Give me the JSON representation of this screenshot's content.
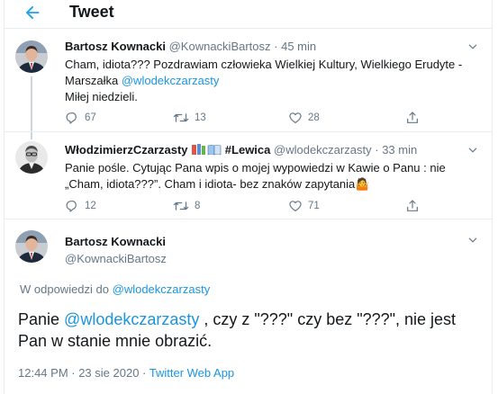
{
  "header": {
    "title": "Tweet"
  },
  "tweets": [
    {
      "name": "Bartosz Kownacki",
      "handle": "@KownackiBartosz",
      "dot": "·",
      "time": "45 min",
      "text_line1": "Cham, idiota??? Pozdrawiam człowieka Wielkiej Kultury, Wielkiego Erudyte -",
      "text_line2_prefix": "Marszałka ",
      "text_line2_mention": "@wlodekczarzasty",
      "text_line3": "Miłej niedzieli.",
      "replies": "67",
      "retweets": "13",
      "likes": "28"
    },
    {
      "name": "WłodzimierzCzarzasty",
      "badge_text": "#Lewica",
      "handle": "@wlodekczarzasty",
      "dot": "·",
      "time": "33 min",
      "text_line1": "Panie pośle. Cytując Pana wpis o mojej wypowiedzi w Kawie o Panu : nie",
      "text_line2": "„Cham, idiota???”.  Cham i idiota- bez znaków zapytania",
      "emoji": "🤷",
      "replies": "12",
      "retweets": "8",
      "likes": "71"
    }
  ],
  "main": {
    "name": "Bartosz Kownacki",
    "handle": "@KownackiBartosz",
    "reply_prefix": "W odpowiedzi do ",
    "reply_mention": "@wlodekczarzasty",
    "text_prefix": "Panie ",
    "text_mention": "@wlodekczarzasty",
    "text_rest": " , czy z \"???\" czy bez \"???\", nie jest Pan w stanie mnie obrazić.",
    "timestamp": "12:44 PM · 23 sie 2020 · ",
    "source": "Twitter Web App"
  },
  "colors": {
    "accent": "#1b95e0",
    "muted": "#657786",
    "border": "#e6ecf0"
  },
  "icons": [
    "back-arrow-icon",
    "chevron-down-icon",
    "reply-icon",
    "retweet-icon",
    "like-icon",
    "share-icon",
    "books-emoji-icon"
  ]
}
